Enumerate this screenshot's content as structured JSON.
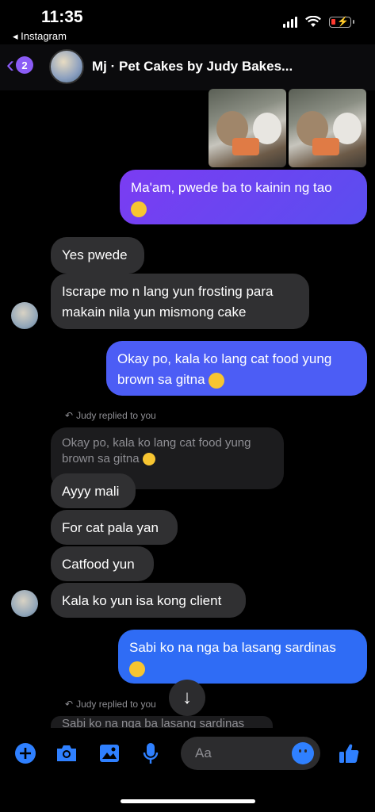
{
  "status": {
    "time": "11:35",
    "back_app": "◂ Instagram"
  },
  "header": {
    "unread_count": "2",
    "title": "Mj · Pet Cakes by Judy Bakes..."
  },
  "messages": {
    "m1": "Ma'am, pwede ba to kainin ng tao",
    "m2": "Yes pwede",
    "m3": "Iscrape mo n lang yun frosting para makain nila yun mismong cake",
    "m4": "Okay po, kala ko lang cat food yung brown sa gitna",
    "reply1": "Judy replied to you",
    "quote1": "Okay po, kala ko lang cat food yung brown sa gitna",
    "m5": "Ayyy mali",
    "m6": "For cat pala yan",
    "m7": "Catfood yun",
    "m8": "Kala ko yun isa kong client",
    "m9": "Sabi ko na nga ba lasang sardinas",
    "reply2": "Judy replied to you",
    "quote2": "Sabi ko na nga ba lasang sardinas"
  },
  "composer": {
    "placeholder": "Aa"
  },
  "colors": {
    "accent": "#8b5cf6",
    "outgoing_top": "#7b3cf2",
    "outgoing_mid": "#4c5df5",
    "outgoing_bottom": "#2f6cf5",
    "incoming": "#303032",
    "icon_blue": "#2f80ff"
  },
  "icons": [
    "chevron-left-icon",
    "signal-icon",
    "wifi-icon",
    "battery-icon",
    "plus-icon",
    "camera-icon",
    "image-icon",
    "mic-icon",
    "emoji-icon",
    "thumbs-up-icon",
    "arrow-down-icon",
    "reply-icon"
  ]
}
